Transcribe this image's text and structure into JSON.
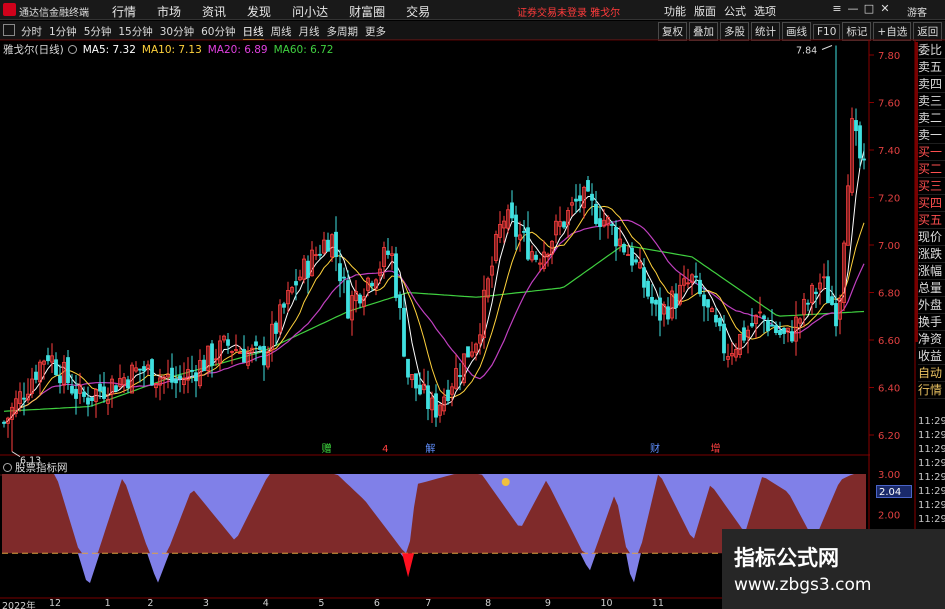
{
  "app": {
    "title": "通达信金融终端"
  },
  "menu": {
    "items": [
      "行情",
      "市场",
      "资讯",
      "发现",
      "问小达",
      "财富圈",
      "交易"
    ]
  },
  "notice": "证券交易未登录  雅戈尔",
  "right_menu": {
    "items": [
      "功能",
      "版面",
      "公式",
      "选项"
    ]
  },
  "window_buttons": [
    "≡",
    "—",
    "□",
    "✕"
  ],
  "guest_label": "游客",
  "periods": [
    "分时",
    "1分钟",
    "5分钟",
    "15分钟",
    "30分钟",
    "60分钟",
    "日线",
    "周线",
    "月线",
    "多周期",
    "更多"
  ],
  "active_period": "日线",
  "tools": [
    "复权",
    "叠加",
    "多股",
    "统计",
    "画线",
    "F10",
    "标记",
    "+自选",
    "返回"
  ],
  "stock": {
    "name": "雅戈尔(日线)"
  },
  "ma_labels": [
    {
      "text": "MA5: 7.32",
      "color": "#ffffff"
    },
    {
      "text": "MA10: 7.13",
      "color": "#ffd23c"
    },
    {
      "text": "MA20: 6.89",
      "color": "#e040e0"
    },
    {
      "text": "MA60: 6.72",
      "color": "#40d040"
    }
  ],
  "colors": {
    "up": "#ff4040",
    "down": "#40e0e0",
    "ma5": "#ffffff",
    "ma10": "#ffd23c",
    "ma20": "#c040c0",
    "ma60": "#40d040",
    "fill_a": "#7f2a2a",
    "fill_b": "#8080e8"
  },
  "price_axis": {
    "min": 6.2,
    "max": 7.8,
    "ticks": [
      "7.80",
      "7.60",
      "7.40",
      "7.20",
      "7.00",
      "6.80",
      "6.60",
      "6.40",
      "6.20"
    ]
  },
  "price_extremes": {
    "high_label": "7.84",
    "low_label": "6.13"
  },
  "event_markers": [
    {
      "t": 0.37,
      "label": "赠",
      "color": "#40e040"
    },
    {
      "t": 0.44,
      "label": "4",
      "color": "#ff4040"
    },
    {
      "t": 0.49,
      "label": "解",
      "color": "#6090ff"
    },
    {
      "t": 0.75,
      "label": "财",
      "color": "#6090ff"
    },
    {
      "t": 0.82,
      "label": "增",
      "color": "#ff4040"
    }
  ],
  "order_book": [
    "委比",
    "卖五",
    "卖四",
    "卖三",
    "卖二",
    "卖一",
    "买一",
    "买二",
    "买三",
    "买四",
    "买五",
    "现价",
    "涨跌",
    "涨幅",
    "总量",
    "外盘",
    "换手",
    "净资",
    "收益"
  ],
  "side_buttons": [
    "自动",
    "行情"
  ],
  "times": [
    "11:29",
    "11:29",
    "11:29",
    "11:29",
    "11:29",
    "11:29",
    "11:29",
    "11:29",
    "11:29",
    "11:29",
    "11:29",
    "11:29",
    "11:29"
  ],
  "sub_panel": {
    "title": "股票指标网",
    "axis": [
      "3.00",
      "2.00",
      "1.00"
    ],
    "current": "2.04"
  },
  "time_axis": [
    {
      "t": 0.0,
      "label": "2022年"
    },
    {
      "t": 0.055,
      "label": "12"
    },
    {
      "t": 0.12,
      "label": "1"
    },
    {
      "t": 0.17,
      "label": "2"
    },
    {
      "t": 0.235,
      "label": "3"
    },
    {
      "t": 0.305,
      "label": "4"
    },
    {
      "t": 0.37,
      "label": "5"
    },
    {
      "t": 0.435,
      "label": "6"
    },
    {
      "t": 0.495,
      "label": "7"
    },
    {
      "t": 0.565,
      "label": "8"
    },
    {
      "t": 0.635,
      "label": "9"
    },
    {
      "t": 0.7,
      "label": "10"
    },
    {
      "t": 0.76,
      "label": "11"
    }
  ],
  "watermark": {
    "line1": "指标公式网",
    "line2": "www.zbgs3.com"
  },
  "chart_data": {
    "type": "candlestick",
    "anchors": [
      [
        0,
        6.25
      ],
      [
        0.05,
        6.55
      ],
      [
        0.09,
        6.35
      ],
      [
        0.16,
        6.48
      ],
      [
        0.2,
        6.42
      ],
      [
        0.26,
        6.58
      ],
      [
        0.3,
        6.52
      ],
      [
        0.34,
        6.85
      ],
      [
        0.38,
        7.05
      ],
      [
        0.4,
        6.75
      ],
      [
        0.45,
        6.98
      ],
      [
        0.47,
        6.45
      ],
      [
        0.5,
        6.3
      ],
      [
        0.55,
        6.62
      ],
      [
        0.58,
        7.12
      ],
      [
        0.62,
        6.95
      ],
      [
        0.67,
        7.2
      ],
      [
        0.7,
        7.1
      ],
      [
        0.73,
        6.95
      ],
      [
        0.76,
        6.7
      ],
      [
        0.8,
        6.85
      ],
      [
        0.84,
        6.55
      ],
      [
        0.88,
        6.7
      ],
      [
        0.91,
        6.6
      ],
      [
        0.95,
        6.85
      ],
      [
        0.97,
        6.7
      ],
      [
        0.985,
        7.5
      ],
      [
        1.0,
        7.3
      ]
    ],
    "ma60_anchors": [
      [
        0,
        6.3
      ],
      [
        0.1,
        6.32
      ],
      [
        0.2,
        6.45
      ],
      [
        0.3,
        6.55
      ],
      [
        0.4,
        6.72
      ],
      [
        0.47,
        6.8
      ],
      [
        0.55,
        6.78
      ],
      [
        0.65,
        6.82
      ],
      [
        0.72,
        7.0
      ],
      [
        0.8,
        6.95
      ],
      [
        0.9,
        6.7
      ],
      [
        1.0,
        6.72
      ]
    ],
    "sub_anchors": [
      [
        0,
        3.0
      ],
      [
        0.06,
        3.0
      ],
      [
        0.1,
        0.2
      ],
      [
        0.14,
        2.8
      ],
      [
        0.18,
        0.3
      ],
      [
        0.22,
        2.5
      ],
      [
        0.27,
        1.2
      ],
      [
        0.31,
        2.9
      ],
      [
        0.38,
        3.0
      ],
      [
        0.42,
        2.2
      ],
      [
        0.47,
        0.8
      ],
      [
        0.48,
        2.6
      ],
      [
        0.55,
        3.0
      ],
      [
        0.6,
        1.5
      ],
      [
        0.63,
        2.7
      ],
      [
        0.68,
        0.6
      ],
      [
        0.71,
        2.4
      ],
      [
        0.73,
        0.2
      ],
      [
        0.76,
        2.9
      ],
      [
        0.8,
        1.2
      ],
      [
        0.82,
        2.6
      ],
      [
        0.86,
        1.4
      ],
      [
        0.88,
        2.8
      ],
      [
        0.91,
        2.4
      ],
      [
        0.94,
        1.2
      ],
      [
        0.97,
        2.7
      ],
      [
        1.0,
        3.0
      ]
    ]
  }
}
